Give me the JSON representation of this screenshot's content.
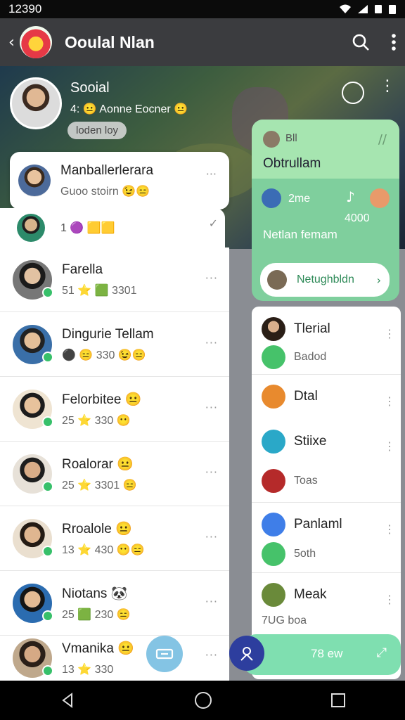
{
  "status": {
    "time": "12390"
  },
  "appbar": {
    "title": "Ooulal Nlan"
  },
  "profile": {
    "name": "Sooial",
    "subtitle": "4: 😐 Aonne Eocner 😐",
    "tag": "loden loy"
  },
  "cards": [
    {
      "name": "Manballerlerara",
      "sub": "Guoo stoirn 😉😑"
    },
    {
      "name": "",
      "sub": "1 🟣 🟨🟨"
    }
  ],
  "contacts": [
    {
      "name": "Farella",
      "sub": "51 ⭐ 🟩 3301"
    },
    {
      "name": "Dingurie Tellam",
      "sub": "⚫ 😑 330 😉😑"
    },
    {
      "name": "Felorbitee 😐",
      "sub": "25 ⭐ 330 😶"
    },
    {
      "name": "Roalorar 😐",
      "sub": "25 ⭐ 3301 😑"
    },
    {
      "name": "Rroalole 😐",
      "sub": "13 ⭐ 430 😶😑"
    },
    {
      "name": "Niotans 🐼",
      "sub": "25 🟩 230 😑"
    },
    {
      "name": "Vmanika 😐",
      "sub": "13 ⭐ 330"
    }
  ],
  "green_panel": {
    "header_small": "Bll",
    "header_title": "Obtrullam",
    "row_label": "2me",
    "row_value": "4000",
    "body_text": "Netlan femam",
    "button": "Netughbldn"
  },
  "right_panel": {
    "items": [
      {
        "label": "Tlerial",
        "sub": "Badod"
      },
      {
        "label": "Dtal",
        "sub": ""
      },
      {
        "label": "Stiixe",
        "sub": "Toas"
      },
      {
        "label": "Panlaml",
        "sub": "5oth"
      },
      {
        "label": "Meak",
        "sub": "7UG boa"
      }
    ]
  },
  "bottom": {
    "green_bar_label": "78 ew"
  },
  "colors": {
    "appbar": "#3b3c3f",
    "accent_green": "#7fcf9d",
    "online_dot": "#37c06a",
    "fab": "#84c4e4"
  }
}
